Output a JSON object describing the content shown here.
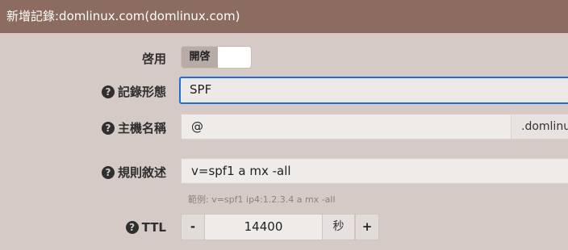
{
  "window": {
    "title": "新增記錄:domlinux.com(domlinux.com)"
  },
  "form": {
    "enabled": {
      "label": "啓用",
      "toggle_label": "開啓",
      "state": "on"
    },
    "record_type": {
      "label": "記錄形態",
      "value": "SPF",
      "help_icon": "question-circle-icon"
    },
    "hostname": {
      "label": "主機名稱",
      "value": "@",
      "suffix": ".domlinux",
      "help_icon": "question-circle-icon"
    },
    "rule": {
      "label": "規則敘述",
      "value": "v=spf1 a mx -all",
      "hint": "範例: v=spf1 ip4:1.2.3.4 a mx -all",
      "help_icon": "question-circle-icon"
    },
    "ttl": {
      "label": "TTL",
      "value": "14400",
      "unit": "秒",
      "decrement": "-",
      "increment": "+",
      "help_icon": "question-circle-icon"
    }
  },
  "colors": {
    "titlebar": "#8c6b60",
    "background": "#d6cac6",
    "focus": "#1e6fd9"
  }
}
